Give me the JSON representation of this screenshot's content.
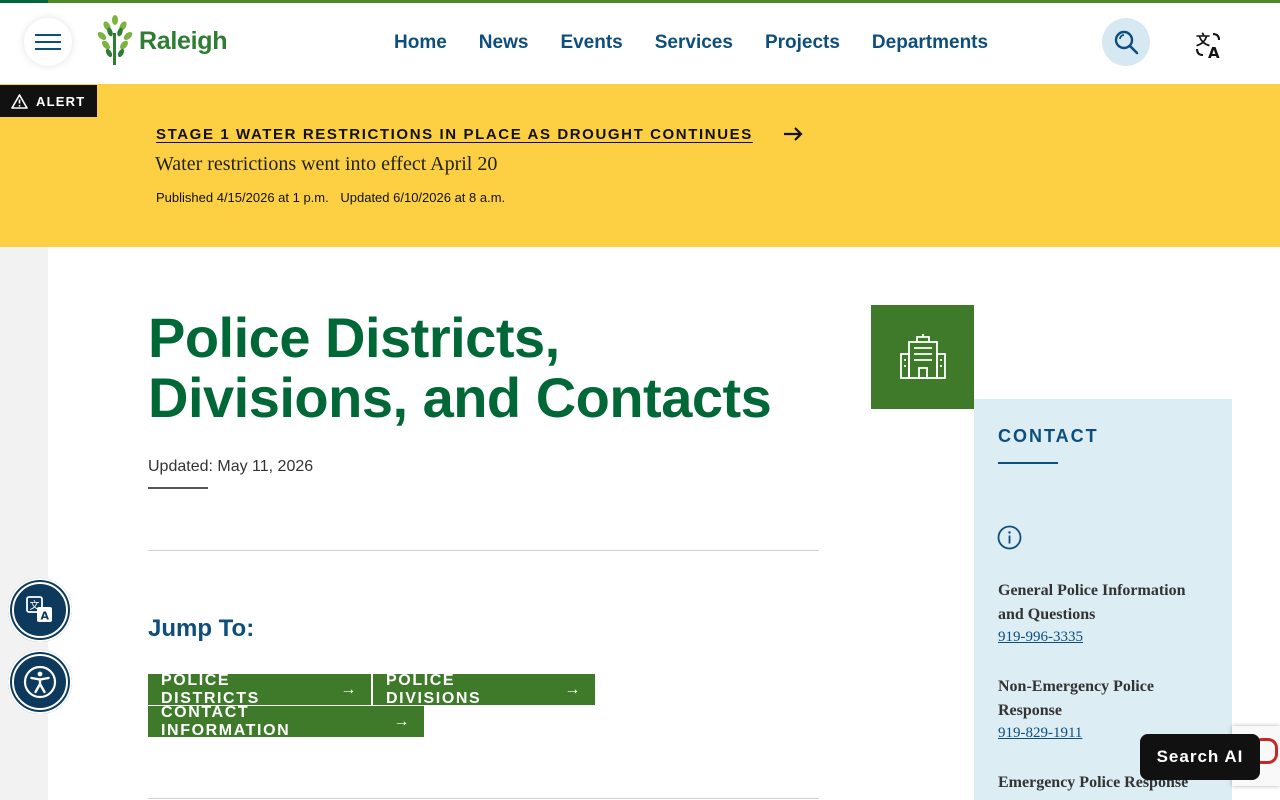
{
  "header": {
    "logo_text": "Raleigh",
    "nav": [
      "Home",
      "News",
      "Events",
      "Services",
      "Projects",
      "Departments"
    ]
  },
  "alert": {
    "tag": "ALERT",
    "headline": "STAGE 1 WATER RESTRICTIONS IN PLACE AS DROUGHT CONTINUES",
    "subtitle": "Water restrictions went into effect April 20",
    "published": "Published 4/15/2026 at 1 p.m.",
    "updated": "Updated 6/10/2026 at 8 a.m."
  },
  "page": {
    "title_line1": "Police Districts,",
    "title_line2": "Divisions, and Contacts",
    "updated": "Updated: May 11, 2026",
    "jump_label": "Jump To:",
    "jump_links": [
      "POLICE DISTRICTS",
      "POLICE DIVISIONS",
      "CONTACT INFORMATION"
    ]
  },
  "contact": {
    "heading": "CONTACT",
    "items": [
      {
        "label": "General Police Information and Questions",
        "phone": "919-996-3335"
      },
      {
        "label": "Non-Emergency Police Response",
        "phone": "919-829-1911"
      },
      {
        "label": "Emergency Police Response",
        "phone": ""
      }
    ]
  },
  "widgets": {
    "search_ai": "Search AI"
  },
  "colors": {
    "brand_green": "#006837",
    "button_green": "#3f7a2a",
    "nav_blue": "#0d4e7d",
    "alert_yellow": "#fdd043",
    "contact_bg": "#dcedf4"
  }
}
